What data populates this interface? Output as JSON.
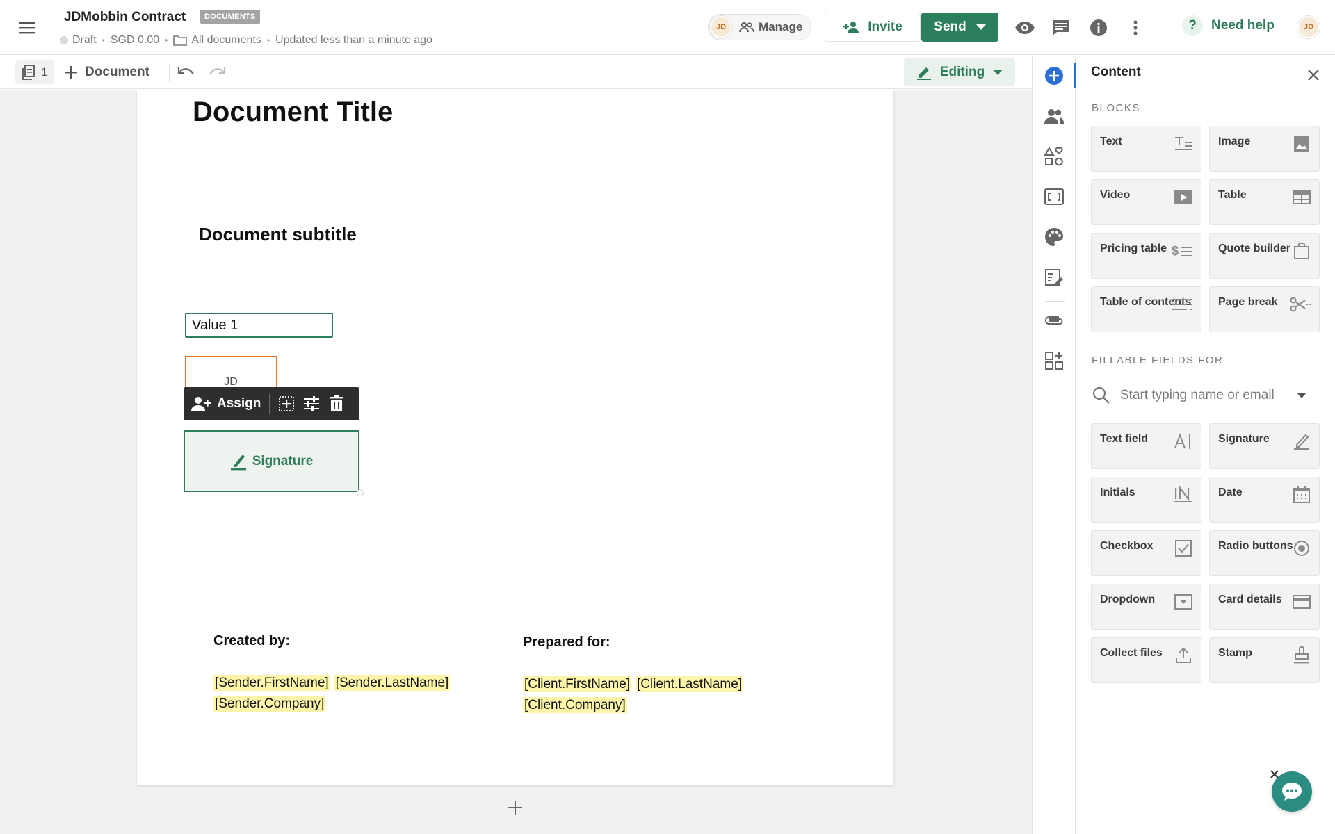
{
  "header": {
    "doc_title": "JDMobbin Contract",
    "badge": "DOCUMENTS",
    "status": "Draft",
    "amount": "SGD 0.00",
    "folder": "All documents",
    "updated": "Updated less than a minute ago",
    "avatar_initials": "JD",
    "manage_label": "Manage",
    "invite_label": "Invite",
    "send_label": "Send",
    "help_label": "Need help",
    "help_glyph": "?",
    "user_initials": "JD"
  },
  "toolbar": {
    "page_count": "1",
    "add_document_label": "Document",
    "editing_label": "Editing"
  },
  "page": {
    "title": "Document Title",
    "subtitle": "Document subtitle",
    "text_field_value": "Value 1",
    "initials_field_label": "JD",
    "field_toolbar": {
      "assign_label": "Assign"
    },
    "signature_field_label": "Signature",
    "created_by_label": "Created by:",
    "prepared_for_label": "Prepared for:",
    "sender_vars": [
      "[Sender.FirstName]",
      "[Sender.LastName]",
      "[Sender.Company]"
    ],
    "client_vars": [
      "[Client.FirstName]",
      "[Client.LastName]",
      "[Client.Company]"
    ]
  },
  "panel": {
    "title": "Content",
    "blocks_label": "BLOCKS",
    "blocks": [
      {
        "label": "Text",
        "icon": "text-icon"
      },
      {
        "label": "Image",
        "icon": "image-icon"
      },
      {
        "label": "Video",
        "icon": "video-icon"
      },
      {
        "label": "Table",
        "icon": "table-icon"
      },
      {
        "label": "Pricing table",
        "icon": "pricing-table-icon"
      },
      {
        "label": "Quote builder",
        "icon": "quote-builder-icon"
      },
      {
        "label": "Table of contents",
        "icon": "table-of-contents-icon"
      },
      {
        "label": "Page break",
        "icon": "page-break-icon"
      }
    ],
    "fillable_label": "FILLABLE FIELDS FOR",
    "search_placeholder": "Start typing name or email",
    "fields": [
      {
        "label": "Text field",
        "icon": "text-field-icon"
      },
      {
        "label": "Signature",
        "icon": "signature-pen-icon"
      },
      {
        "label": "Initials",
        "icon": "initials-icon"
      },
      {
        "label": "Date",
        "icon": "calendar-icon"
      },
      {
        "label": "Checkbox",
        "icon": "checkbox-icon"
      },
      {
        "label": "Radio buttons",
        "icon": "radio-icon"
      },
      {
        "label": "Dropdown",
        "icon": "dropdown-icon"
      },
      {
        "label": "Card details",
        "icon": "card-icon"
      },
      {
        "label": "Collect files",
        "icon": "upload-icon"
      },
      {
        "label": "Stamp",
        "icon": "stamp-icon"
      }
    ]
  },
  "colors": {
    "brand_green": "#2b7f5c",
    "accent_blue": "#2b6fd6",
    "highlight_yellow": "#fdf5a9",
    "initials_orange": "#e0712e",
    "chat_teal": "#2b8c81"
  }
}
